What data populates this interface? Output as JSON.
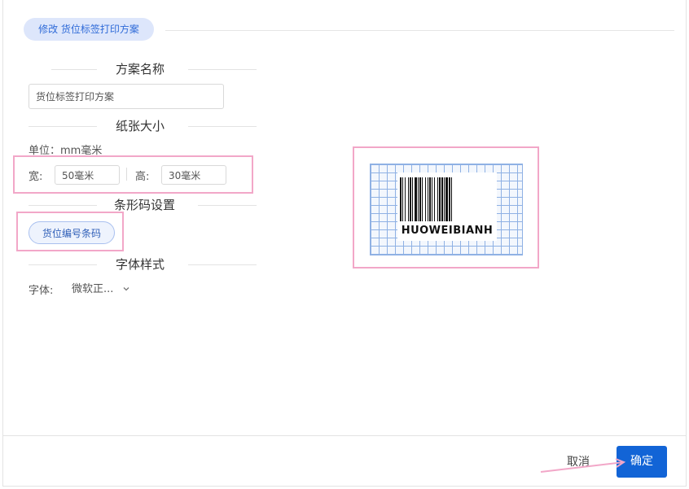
{
  "header": {
    "tab_label": "修改 货位标签打印方案"
  },
  "sections": {
    "name_title": "方案名称",
    "paper_title": "纸张大小",
    "barcode_title": "条形码设置",
    "font_title": "字体样式"
  },
  "scheme": {
    "name_value": "货位标签打印方案"
  },
  "paper": {
    "unit_label": "单位：mm毫米",
    "width_label": "宽:",
    "width_value": "50毫米",
    "height_label": "高:",
    "height_value": "30毫米"
  },
  "barcode": {
    "field_button": "货位编号条码"
  },
  "font": {
    "label": "字体:",
    "selected": "微软正..."
  },
  "preview": {
    "barcode_text": "HUOWEIBIANH"
  },
  "footer": {
    "cancel_label": "取消",
    "ok_label": "确定"
  },
  "colors": {
    "primary": "#1264d6",
    "highlight": "#f2a7c8",
    "pill_bg": "#dde6fb"
  }
}
